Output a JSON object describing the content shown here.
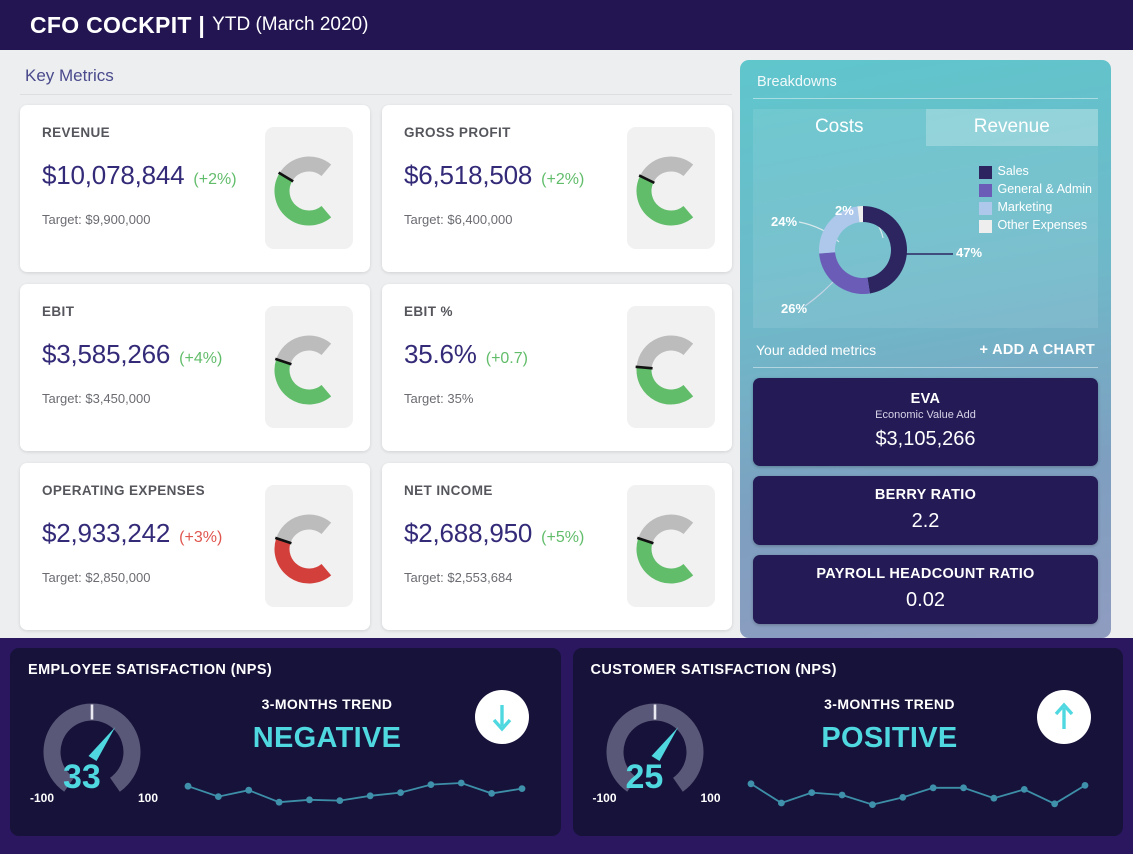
{
  "header": {
    "title_bold": "CFO COCKPIT |",
    "title_sub": "YTD (March 2020)"
  },
  "key_metrics": {
    "section_label": "Key Metrics",
    "cards": [
      {
        "label": "REVENUE",
        "value": "$10,078,844",
        "delta": "(+2%)",
        "delta_dir": "up",
        "target": "Target: $9,900,000",
        "gauge_pct": 62,
        "gauge_color": "#62bd6b"
      },
      {
        "label": "GROSS PROFIT",
        "value": "$6,518,508",
        "delta": "(+2%)",
        "delta_dir": "up",
        "target": "Target: $6,400,000",
        "gauge_pct": 60,
        "gauge_color": "#62bd6b"
      },
      {
        "label": "EBIT",
        "value": "$3,585,266",
        "delta": "(+4%)",
        "delta_dir": "up",
        "target": "Target: $3,450,000",
        "gauge_pct": 57,
        "gauge_color": "#62bd6b"
      },
      {
        "label": "EBIT %",
        "value": "35.6%",
        "delta": "(+0.7)",
        "delta_dir": "up",
        "target": "Target: 35%",
        "gauge_pct": 52,
        "gauge_color": "#62bd6b"
      },
      {
        "label": "OPERATING EXPENSES",
        "value": "$2,933,242",
        "delta": "(+3%)",
        "delta_dir": "down",
        "target": "Target: $2,850,000",
        "gauge_pct": 57,
        "gauge_color": "#d3403c"
      },
      {
        "label": "NET INCOME",
        "value": "$2,688,950",
        "delta": "(+5%)",
        "delta_dir": "up",
        "target": "Target: $2,553,684",
        "gauge_pct": 57,
        "gauge_color": "#62bd6b"
      }
    ]
  },
  "breakdowns": {
    "title": "Breakdowns",
    "tabs": [
      {
        "label": "Costs",
        "active": true
      },
      {
        "label": "Revenue",
        "active": false
      }
    ],
    "added_metrics_label": "Your added metrics",
    "add_chart_label": "+  ADD A CHART",
    "metric_cards": [
      {
        "title": "EVA",
        "subtitle": "Economic Value Add",
        "value": "$3,105,266"
      },
      {
        "title": "BERRY RATIO",
        "subtitle": "",
        "value": "2.2"
      },
      {
        "title": "PAYROLL HEADCOUNT RATIO",
        "subtitle": "",
        "value": "0.02"
      }
    ]
  },
  "chart_data": [
    {
      "type": "pie",
      "title": "Costs",
      "labels": [
        "Sales",
        "General & Admin",
        "Marketing",
        "Other Expenses"
      ],
      "values": [
        47,
        26,
        24,
        2
      ],
      "value_labels": [
        "47%",
        "26%",
        "24%",
        "2%"
      ],
      "colors": [
        "#2d2560",
        "#6b5cb8",
        "#aec8ec",
        "#eeeeee"
      ],
      "legend_position": "right",
      "donut": true
    },
    {
      "type": "line",
      "title": "Employee Satisfaction (NPS) 3-months trend",
      "x": [
        1,
        2,
        3,
        4,
        5,
        6,
        7,
        8,
        9,
        10,
        11,
        12
      ],
      "values": [
        62,
        36,
        52,
        22,
        28,
        26,
        38,
        46,
        66,
        70,
        44,
        56
      ],
      "ylim": [
        0,
        100
      ],
      "grid": false,
      "color": "#3d8fa8"
    },
    {
      "type": "line",
      "title": "Customer Satisfaction (NPS) 3-months trend",
      "x": [
        1,
        2,
        3,
        4,
        5,
        6,
        7,
        8,
        9,
        10,
        11,
        12
      ],
      "values": [
        68,
        20,
        46,
        40,
        16,
        34,
        58,
        58,
        32,
        54,
        18,
        64
      ],
      "ylim": [
        0,
        100
      ],
      "grid": false,
      "color": "#3d8fa8"
    }
  ],
  "nps_panels": [
    {
      "title": "EMPLOYEE SATISFACTION (NPS)",
      "score": "33",
      "scale_min": "-100",
      "scale_max": "100",
      "trend_label": "3-MONTHS TREND",
      "trend_value": "NEGATIVE",
      "arrow": "down-arrow-icon"
    },
    {
      "title": "CUSTOMER SATISFACTION (NPS)",
      "score": "25",
      "scale_min": "-100",
      "scale_max": "100",
      "trend_label": "3-MONTHS TREND",
      "trend_value": "POSITIVE",
      "arrow": "up-arrow-icon"
    }
  ]
}
